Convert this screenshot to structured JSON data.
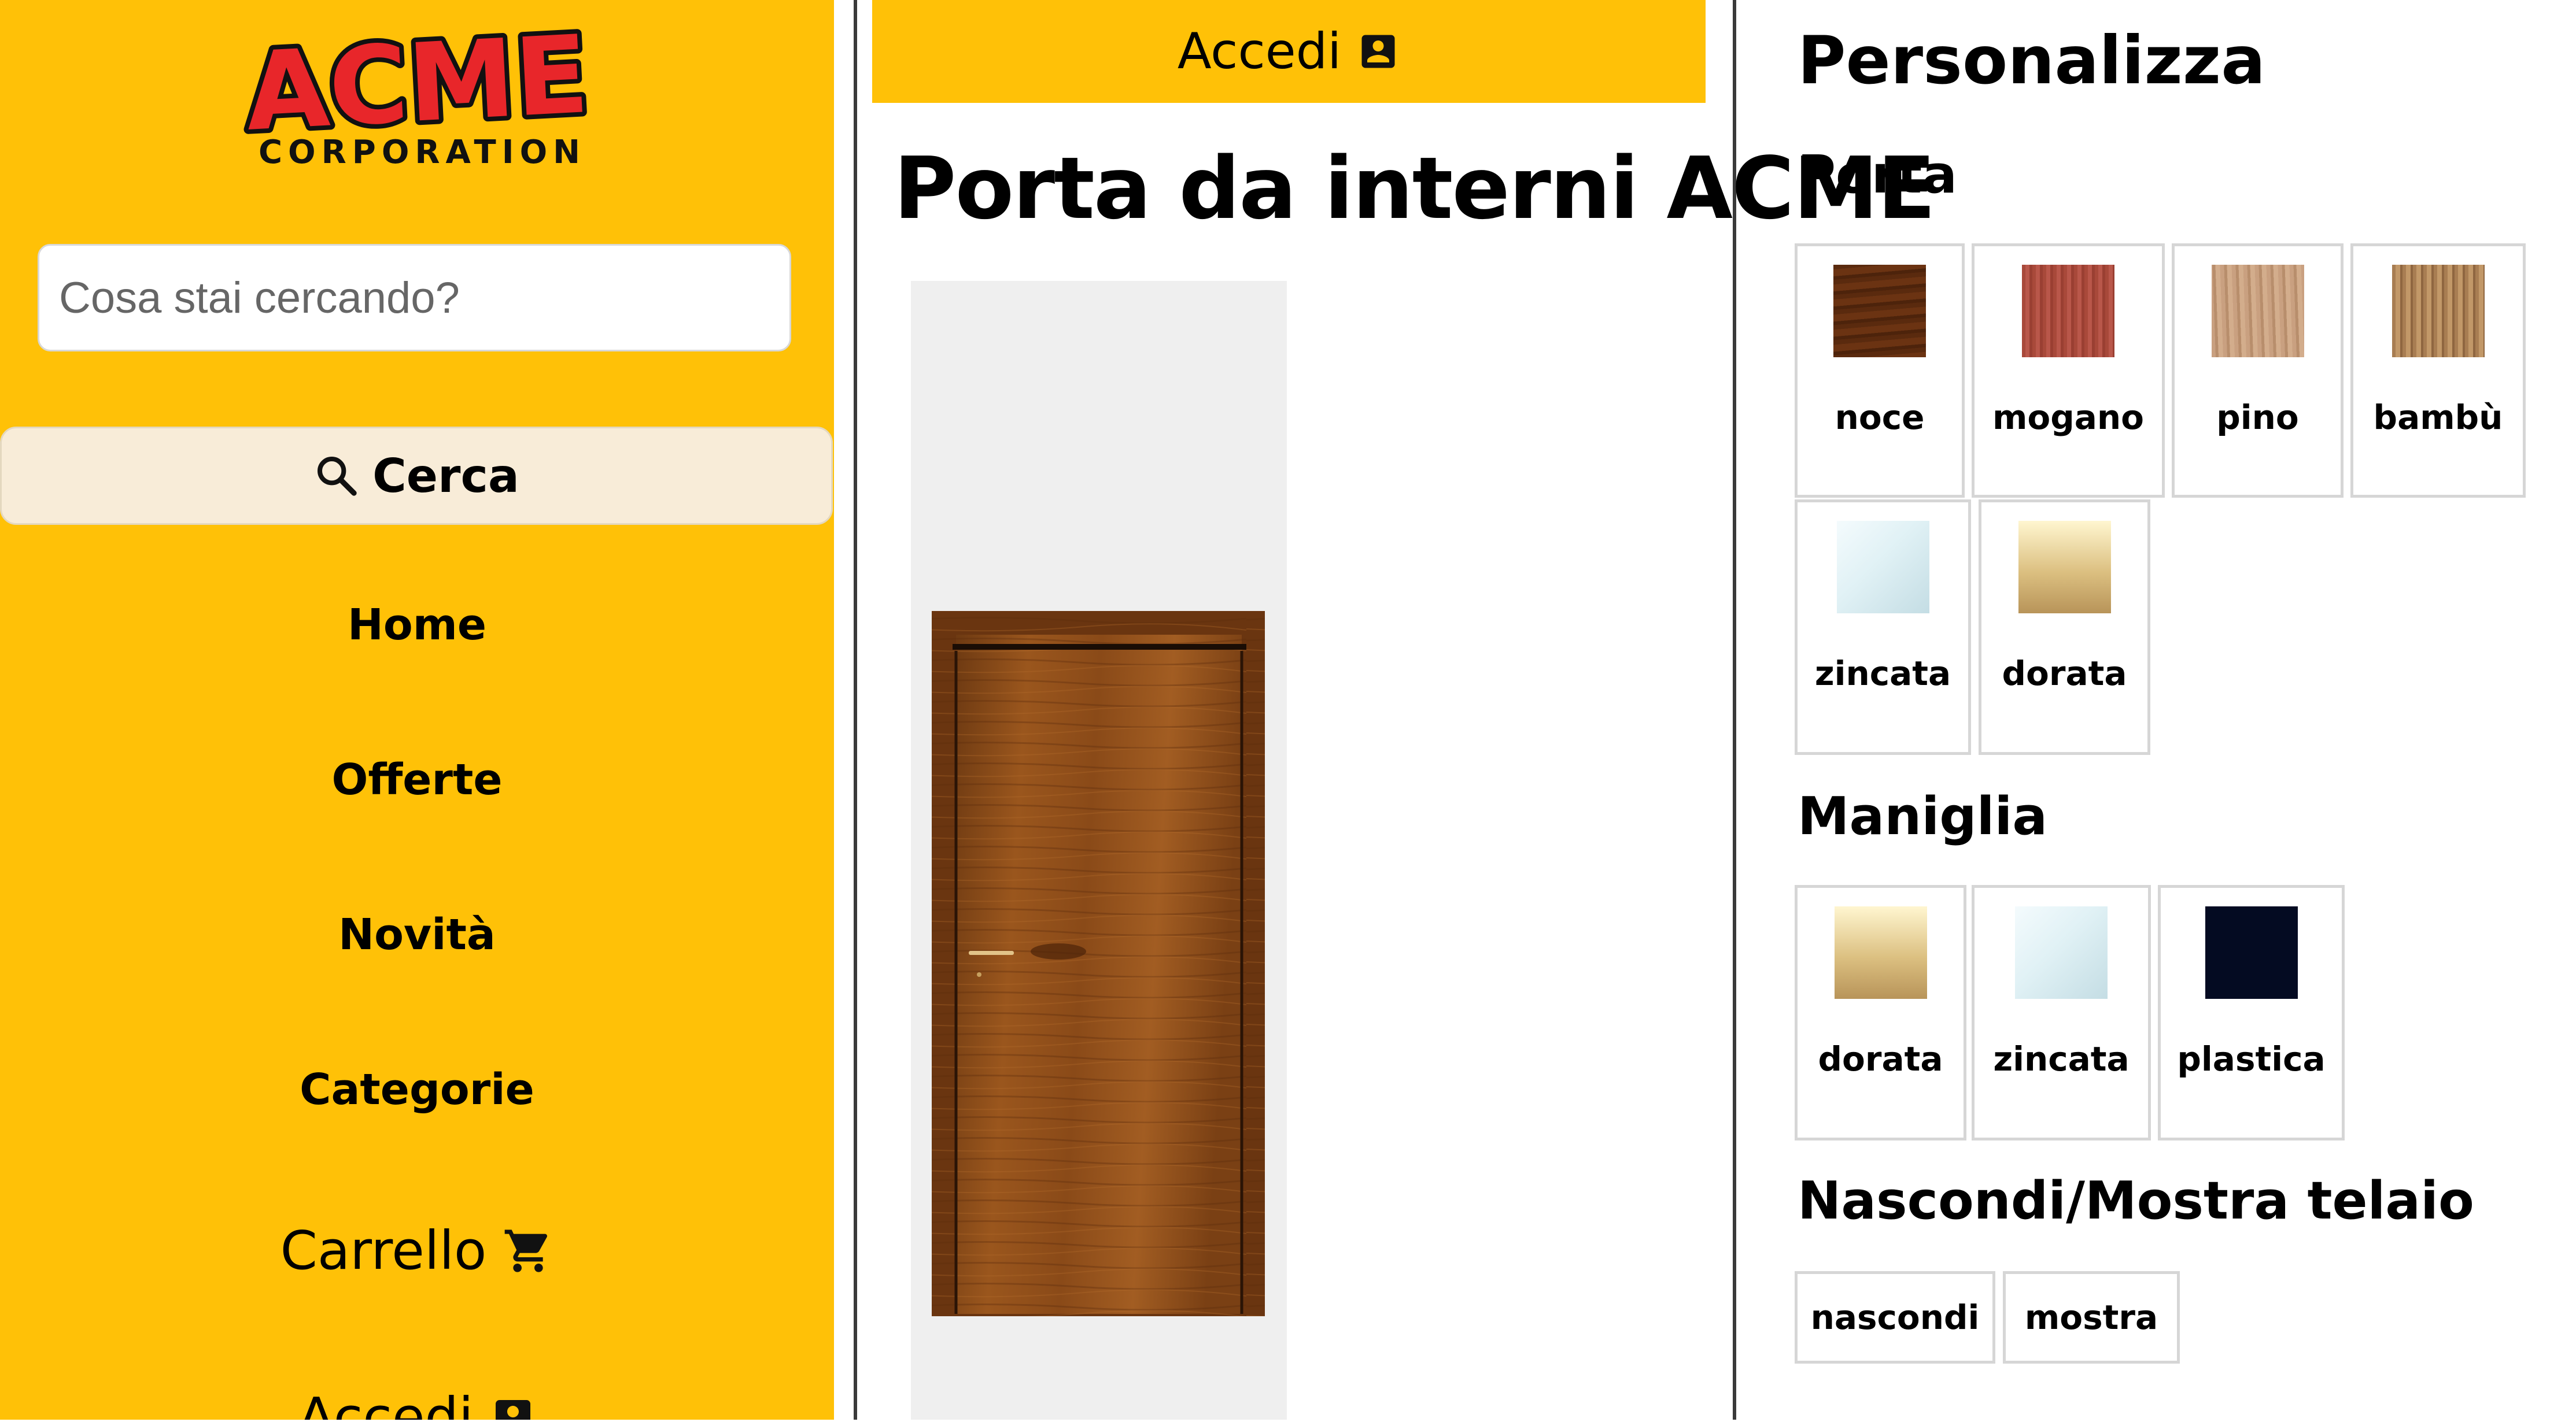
{
  "sidebar": {
    "logo": {
      "word": "ACME",
      "sub": "CORPORATION"
    },
    "search": {
      "placeholder": "Cosa stai cercando?",
      "button_label": "Cerca",
      "icon": "search-icon"
    },
    "nav": {
      "home": "Home",
      "offerte": "Offerte",
      "novita": "Novità",
      "categorie": "Categorie",
      "carrello": "Carrello",
      "accedi": "Accedi"
    },
    "cart_icon": "cart-icon",
    "account_icon": "account-box-icon"
  },
  "main": {
    "login_label": "Accedi",
    "product_title": "Porta da interni ACME"
  },
  "customize": {
    "title": "Personalizza",
    "door_section": "Porta",
    "door_options": [
      "noce",
      "mogano",
      "pino",
      "bambù",
      "zincata",
      "dorata"
    ],
    "handle_section": "Maniglia",
    "handle_options": [
      "dorata",
      "zincata",
      "plastica"
    ],
    "frame_section": "Nascondi/Mostra telaio",
    "frame_options": [
      "nascondi",
      "mostra"
    ]
  },
  "colors": {
    "brand_yellow": "#FFC107",
    "search_button_bg": "#F8ECD8",
    "viewer_bg": "#EFEFEF",
    "logo_red": "#E8262A"
  }
}
